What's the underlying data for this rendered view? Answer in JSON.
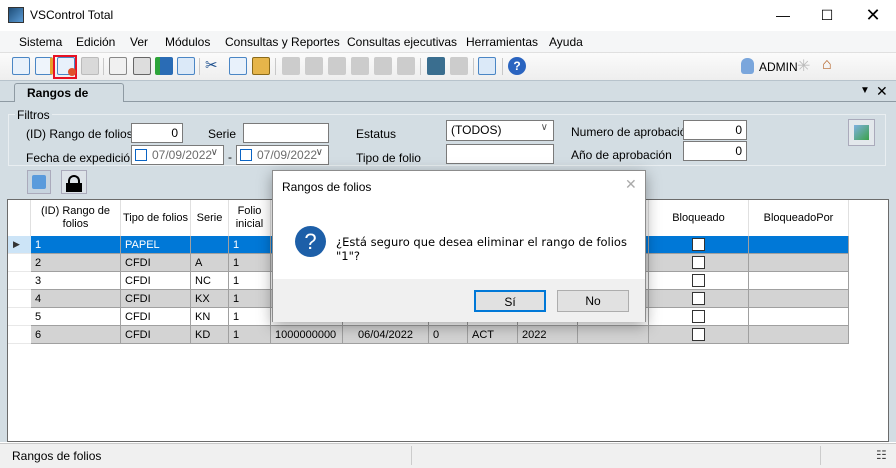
{
  "window": {
    "title": "VSControl Total",
    "controls": [
      "minimize",
      "maximize",
      "close"
    ]
  },
  "menu": [
    "Sistema",
    "Edición",
    "Ver",
    "Módulos",
    "Consultas y Reportes",
    "Consultas ejecutivas",
    "Herramientas",
    "Ayuda"
  ],
  "toolbar": {
    "user": "ADMIN",
    "highlighted_button": "delete-document",
    "highlight_color": "#e81123"
  },
  "tab": {
    "label": "Rangos de folios"
  },
  "filters": {
    "group_label": "Filtros",
    "id_label": "(ID) Rango de folios",
    "id_value": "0",
    "serie_label": "Serie",
    "serie_value": "",
    "fecha_label": "Fecha de expedición",
    "fecha_from": "07/09/2022",
    "fecha_sep": "-",
    "fecha_to": "07/09/2022",
    "estatus_label": "Estatus",
    "estatus_value": "(TODOS)",
    "tipo_label": "Tipo de folio",
    "tipo_value": "",
    "numero_label": "Numero de aprobación",
    "numero_value": "0",
    "anio_label": "Año de aprobación",
    "anio_value": "0"
  },
  "grid": {
    "headers": [
      "(ID) Rango de folios",
      "Tipo de folios",
      "Serie",
      "Folio inicial",
      "",
      "",
      "",
      "",
      "",
      "",
      "Bloqueado",
      "BloqueadoPor"
    ],
    "rows": [
      [
        "1",
        "PAPEL",
        "",
        "1",
        "",
        "",
        "",
        "",
        "",
        "",
        "",
        ""
      ],
      [
        "2",
        "CFDI",
        "A",
        "1",
        "",
        "",
        "",
        "",
        "",
        "",
        "",
        ""
      ],
      [
        "3",
        "CFDI",
        "NC",
        "1",
        "",
        "",
        "",
        "",
        "",
        "",
        "",
        ""
      ],
      [
        "4",
        "CFDI",
        "KX",
        "1",
        "",
        "",
        "",
        "",
        "",
        "",
        "",
        ""
      ],
      [
        "5",
        "CFDI",
        "KN",
        "1",
        "",
        "",
        "",
        "",
        "",
        "",
        "",
        ""
      ],
      [
        "6",
        "CFDI",
        "KD",
        "1",
        "1000000000",
        "06/04/2022",
        "0",
        "ACT",
        "2022",
        "",
        "",
        ""
      ]
    ],
    "selected_row": 0,
    "selection_color": "#0078d7"
  },
  "dialog": {
    "title": "Rangos de folios",
    "message": "¿Está seguro que desea eliminar el rango de folios \"1\"?",
    "yes": "Sí",
    "no": "No"
  },
  "status": {
    "text": "Rangos de folios"
  }
}
